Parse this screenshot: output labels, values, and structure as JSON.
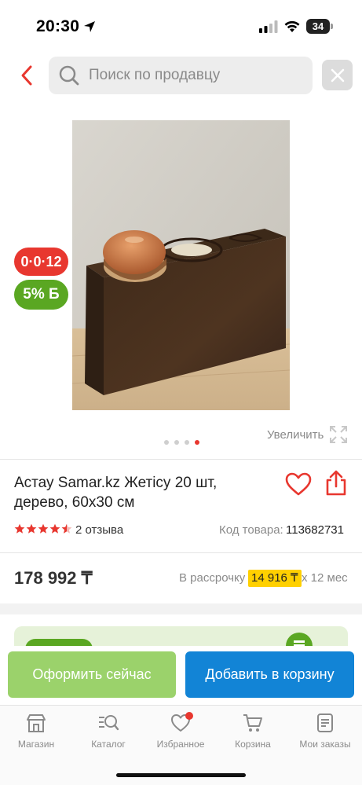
{
  "status_bar": {
    "time": "20:30",
    "battery": "34"
  },
  "header": {
    "search_placeholder": "Поиск по продавцу"
  },
  "gallery": {
    "badge_installment": "0·0·12",
    "badge_bonus": "5% Б",
    "zoom_label": "Увеличить",
    "pages": 4,
    "active_page": 4
  },
  "product": {
    "title": "Астау Samar.kz Жетісу 20 шт, дерево, 60x30 см",
    "rating": 4.5,
    "reviews": "2 отзыва",
    "code_label": "Код товара:",
    "code_value": "113682731"
  },
  "pricing": {
    "price": "178 992 ₸",
    "installment_label": "В рассрочку",
    "installment_value": "14 916 ₸",
    "installment_months": "х 12 мес"
  },
  "actions": {
    "checkout": "Оформить сейчас",
    "add_to_cart": "Добавить в корзину"
  },
  "tabs": [
    {
      "label": "Магазин",
      "icon": "shop-icon"
    },
    {
      "label": "Каталог",
      "icon": "catalog-search-icon"
    },
    {
      "label": "Избранное",
      "icon": "heart-icon"
    },
    {
      "label": "Корзина",
      "icon": "cart-icon"
    },
    {
      "label": "Мои заказы",
      "icon": "orders-icon"
    }
  ],
  "colors": {
    "accent_red": "#e8372f",
    "green": "#5aa722",
    "checkout_green": "#9bd26b",
    "cart_blue": "#1284d6",
    "installment_yellow": "#ffd000"
  }
}
